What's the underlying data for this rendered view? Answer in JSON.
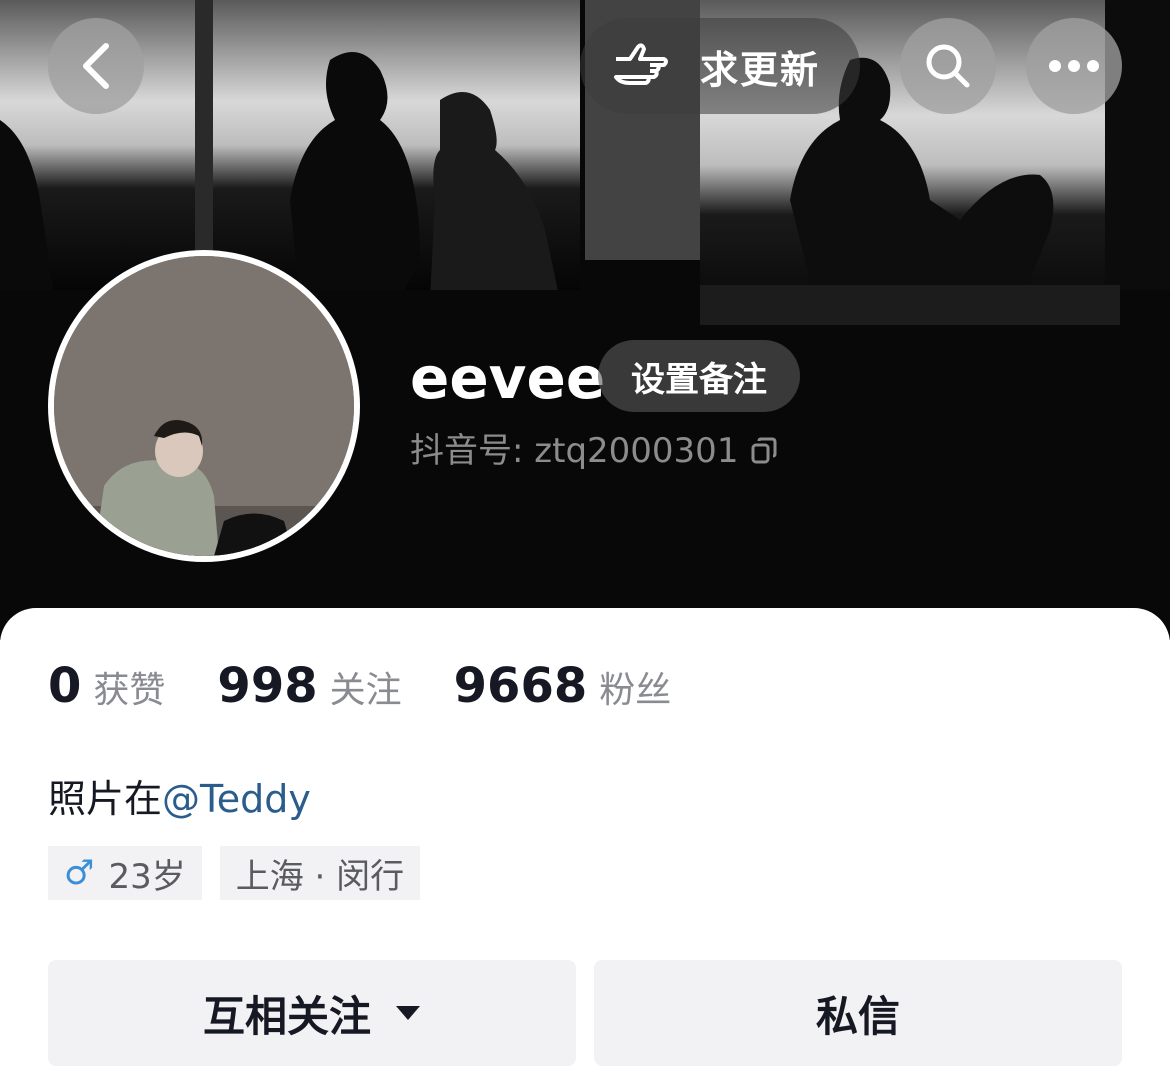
{
  "header": {
    "request_update_label": "求更新",
    "icons": [
      "chevron-left-icon",
      "pointing-hand-icon",
      "search-icon",
      "more-icon"
    ]
  },
  "profile": {
    "nickname": "eevee",
    "remark_button": "设置备注",
    "douyin_id": "抖音号: ztq2000301"
  },
  "stats": [
    {
      "value": "0",
      "label": "获赞"
    },
    {
      "value": "998",
      "label": "关注"
    },
    {
      "value": "9668",
      "label": "粉丝"
    }
  ],
  "bio": {
    "text": "照片在",
    "mention": "@Teddy"
  },
  "tags": {
    "gender_symbol": "♂",
    "age": "23岁",
    "location": "上海 · 闵行"
  },
  "actions": {
    "follow_label": "互相关注",
    "message_label": "私信"
  },
  "colors": {
    "mention": "#2b5d8c",
    "gender": "#3a8fd6",
    "text_primary": "#161823",
    "text_secondary": "#8a8b91"
  }
}
